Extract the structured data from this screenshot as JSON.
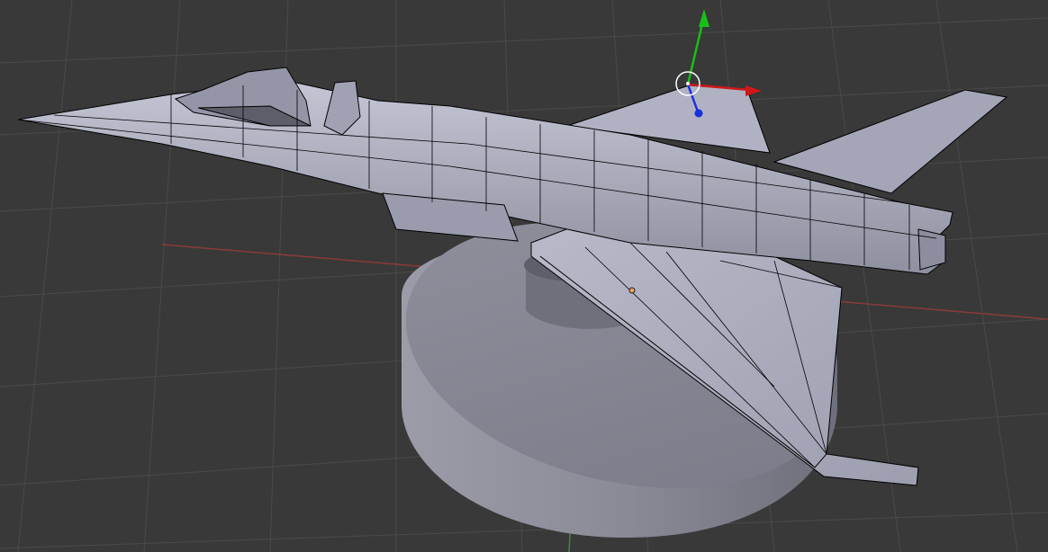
{
  "viewport": {
    "background": "#393939",
    "grid_color": "#4a4a4a",
    "axis_x_color": "#8a3a3a",
    "axis_y_color": "#3a8a3a"
  },
  "scene": {
    "objects": [
      "fighter-jet-mesh",
      "display-stand"
    ],
    "mesh_color": "#a9abbb",
    "wire_color": "#000000",
    "stand_color": "#7e7f8c",
    "origin_marker_color": "#e8a060"
  },
  "gizmo": {
    "x_color": "#d01818",
    "y_color": "#18c018",
    "z_color": "#1830e0"
  }
}
